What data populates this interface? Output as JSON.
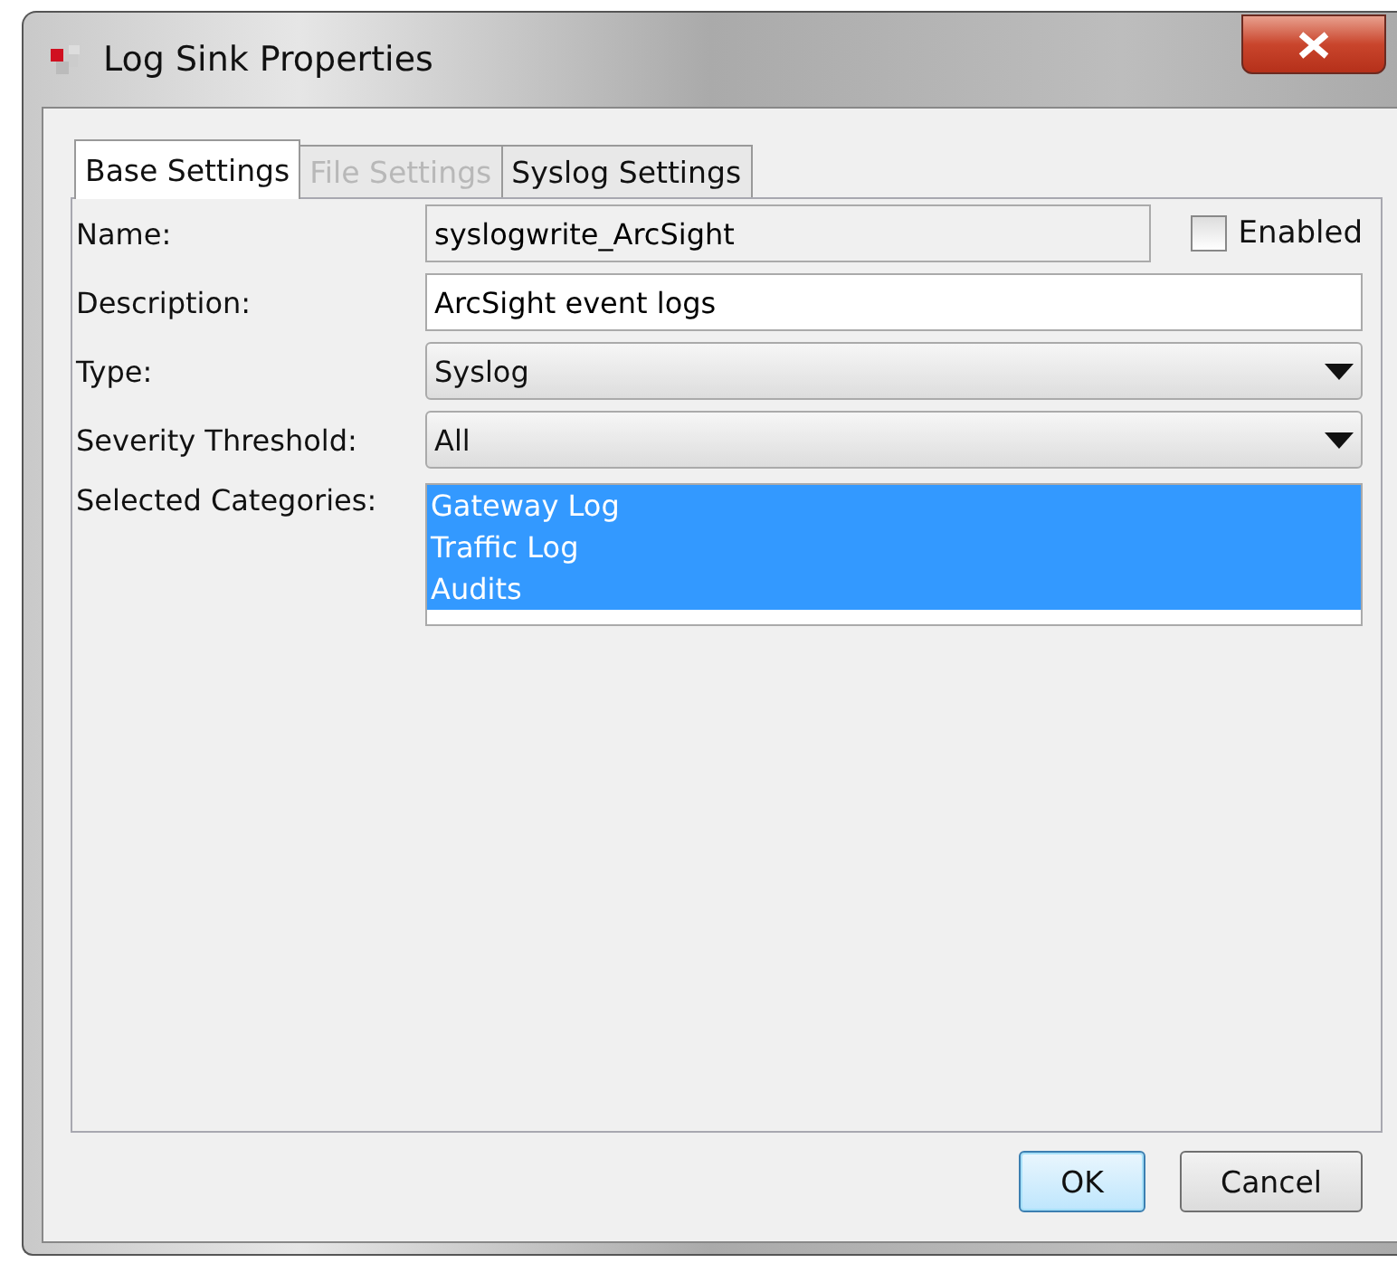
{
  "window": {
    "title": "Log Sink Properties"
  },
  "tabs": [
    {
      "label": "Base Settings",
      "selected": true,
      "disabled": false
    },
    {
      "label": "File Settings",
      "selected": false,
      "disabled": true
    },
    {
      "label": "Syslog Settings",
      "selected": false,
      "disabled": false
    }
  ],
  "form": {
    "name": {
      "label": "Name:",
      "value": "syslogwrite_ArcSight",
      "editable": false
    },
    "enabled": {
      "label": "Enabled",
      "checked": false
    },
    "description": {
      "label": "Description:",
      "value": "ArcSight event logs"
    },
    "type": {
      "label": "Type:",
      "value": "Syslog"
    },
    "severity_threshold": {
      "label": "Severity Threshold:",
      "value": "All"
    },
    "selected_categories": {
      "label": "Selected Categories:",
      "items": [
        {
          "label": "Gateway Log",
          "selected": true
        },
        {
          "label": "Traffic Log",
          "selected": true
        },
        {
          "label": "Audits",
          "selected": true
        }
      ]
    }
  },
  "buttons": [
    {
      "label": "OK",
      "default": true
    },
    {
      "label": "Cancel",
      "default": false
    }
  ]
}
